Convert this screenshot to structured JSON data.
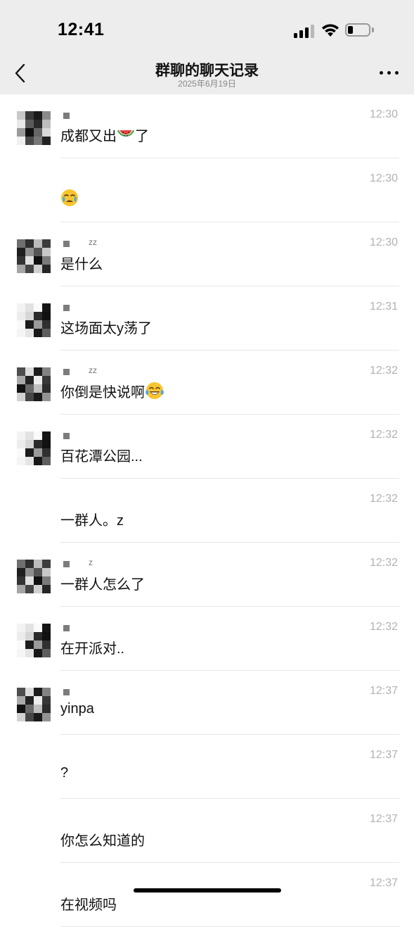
{
  "status_bar": {
    "time": "12:41",
    "signal_bars": 3,
    "battery_level": 0.25
  },
  "header": {
    "title": "群聊的聊天记录",
    "date": "2025年6月19日",
    "back_icon": "chevron-left-icon",
    "more_icon": "more-horizontal-icon"
  },
  "messages": [
    {
      "time": "12:30",
      "text": "成都又出",
      "emoji": "watermelon",
      "text_after": "了",
      "sender_suffix": "",
      "avatar_id": 0
    },
    {
      "time": "12:30",
      "text": "",
      "emoji": "crying-face",
      "text_after": "",
      "sender_suffix": "",
      "avatar_id": -1
    },
    {
      "time": "12:30",
      "text": "是什么",
      "emoji": "",
      "text_after": "",
      "sender_suffix": "zz",
      "avatar_id": 1
    },
    {
      "time": "12:31",
      "text": "这场面太y荡了",
      "emoji": "",
      "text_after": "",
      "sender_suffix": "",
      "avatar_id": 2
    },
    {
      "time": "12:32",
      "text": "你倒是快说啊",
      "emoji": "tears-of-joy",
      "text_after": "",
      "sender_suffix": "zz",
      "avatar_id": 3
    },
    {
      "time": "12:32",
      "text": "百花潭公园...",
      "emoji": "",
      "text_after": "",
      "sender_suffix": "",
      "avatar_id": 2
    },
    {
      "time": "12:32",
      "text": "一群人。z",
      "emoji": "",
      "text_after": "",
      "sender_suffix": "",
      "avatar_id": -1
    },
    {
      "time": "12:32",
      "text": "一群人怎么了",
      "emoji": "",
      "text_after": "",
      "sender_suffix": "z",
      "avatar_id": 1
    },
    {
      "time": "12:32",
      "text": "在开派对..",
      "emoji": "",
      "text_after": "",
      "sender_suffix": "",
      "avatar_id": 2
    },
    {
      "time": "12:37",
      "text": "yinpa",
      "emoji": "",
      "text_after": "",
      "sender_suffix": "",
      "avatar_id": 3
    },
    {
      "time": "12:37",
      "text": "?",
      "emoji": "",
      "text_after": "",
      "sender_suffix": "",
      "avatar_id": -1
    },
    {
      "time": "12:37",
      "text": "你怎么知道的",
      "emoji": "",
      "text_after": "",
      "sender_suffix": "",
      "avatar_id": -1
    },
    {
      "time": "12:37",
      "text": "在视频吗",
      "emoji": "",
      "text_after": "",
      "sender_suffix": "",
      "avatar_id": -1
    }
  ],
  "colors": {
    "header_bg": "#ededed",
    "timestamp": "#b2b2b2",
    "divider": "#e6e6e6"
  }
}
